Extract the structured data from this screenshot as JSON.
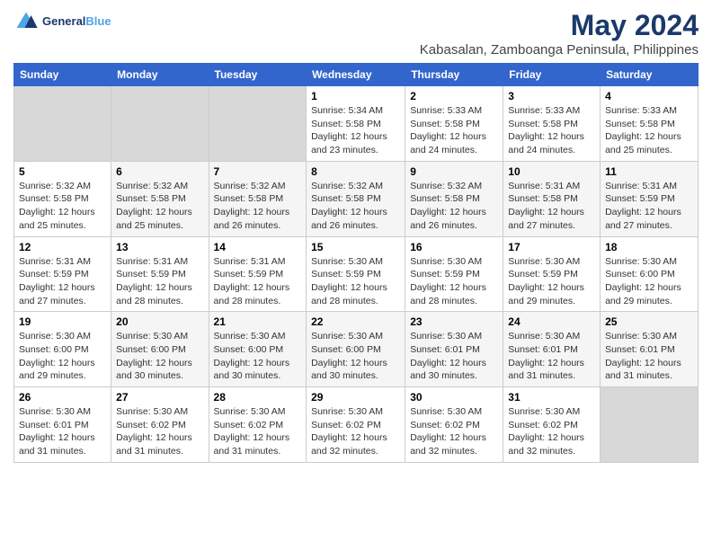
{
  "header": {
    "logo_line1": "General",
    "logo_line2": "Blue",
    "title": "May 2024",
    "subtitle": "Kabasalan, Zamboanga Peninsula, Philippines"
  },
  "calendar": {
    "days_of_week": [
      "Sunday",
      "Monday",
      "Tuesday",
      "Wednesday",
      "Thursday",
      "Friday",
      "Saturday"
    ],
    "weeks": [
      [
        {
          "day": "",
          "info": ""
        },
        {
          "day": "",
          "info": ""
        },
        {
          "day": "",
          "info": ""
        },
        {
          "day": "1",
          "info": "Sunrise: 5:34 AM\nSunset: 5:58 PM\nDaylight: 12 hours\nand 23 minutes."
        },
        {
          "day": "2",
          "info": "Sunrise: 5:33 AM\nSunset: 5:58 PM\nDaylight: 12 hours\nand 24 minutes."
        },
        {
          "day": "3",
          "info": "Sunrise: 5:33 AM\nSunset: 5:58 PM\nDaylight: 12 hours\nand 24 minutes."
        },
        {
          "day": "4",
          "info": "Sunrise: 5:33 AM\nSunset: 5:58 PM\nDaylight: 12 hours\nand 25 minutes."
        }
      ],
      [
        {
          "day": "5",
          "info": "Sunrise: 5:32 AM\nSunset: 5:58 PM\nDaylight: 12 hours\nand 25 minutes."
        },
        {
          "day": "6",
          "info": "Sunrise: 5:32 AM\nSunset: 5:58 PM\nDaylight: 12 hours\nand 25 minutes."
        },
        {
          "day": "7",
          "info": "Sunrise: 5:32 AM\nSunset: 5:58 PM\nDaylight: 12 hours\nand 26 minutes."
        },
        {
          "day": "8",
          "info": "Sunrise: 5:32 AM\nSunset: 5:58 PM\nDaylight: 12 hours\nand 26 minutes."
        },
        {
          "day": "9",
          "info": "Sunrise: 5:32 AM\nSunset: 5:58 PM\nDaylight: 12 hours\nand 26 minutes."
        },
        {
          "day": "10",
          "info": "Sunrise: 5:31 AM\nSunset: 5:58 PM\nDaylight: 12 hours\nand 27 minutes."
        },
        {
          "day": "11",
          "info": "Sunrise: 5:31 AM\nSunset: 5:59 PM\nDaylight: 12 hours\nand 27 minutes."
        }
      ],
      [
        {
          "day": "12",
          "info": "Sunrise: 5:31 AM\nSunset: 5:59 PM\nDaylight: 12 hours\nand 27 minutes."
        },
        {
          "day": "13",
          "info": "Sunrise: 5:31 AM\nSunset: 5:59 PM\nDaylight: 12 hours\nand 28 minutes."
        },
        {
          "day": "14",
          "info": "Sunrise: 5:31 AM\nSunset: 5:59 PM\nDaylight: 12 hours\nand 28 minutes."
        },
        {
          "day": "15",
          "info": "Sunrise: 5:30 AM\nSunset: 5:59 PM\nDaylight: 12 hours\nand 28 minutes."
        },
        {
          "day": "16",
          "info": "Sunrise: 5:30 AM\nSunset: 5:59 PM\nDaylight: 12 hours\nand 28 minutes."
        },
        {
          "day": "17",
          "info": "Sunrise: 5:30 AM\nSunset: 5:59 PM\nDaylight: 12 hours\nand 29 minutes."
        },
        {
          "day": "18",
          "info": "Sunrise: 5:30 AM\nSunset: 6:00 PM\nDaylight: 12 hours\nand 29 minutes."
        }
      ],
      [
        {
          "day": "19",
          "info": "Sunrise: 5:30 AM\nSunset: 6:00 PM\nDaylight: 12 hours\nand 29 minutes."
        },
        {
          "day": "20",
          "info": "Sunrise: 5:30 AM\nSunset: 6:00 PM\nDaylight: 12 hours\nand 30 minutes."
        },
        {
          "day": "21",
          "info": "Sunrise: 5:30 AM\nSunset: 6:00 PM\nDaylight: 12 hours\nand 30 minutes."
        },
        {
          "day": "22",
          "info": "Sunrise: 5:30 AM\nSunset: 6:00 PM\nDaylight: 12 hours\nand 30 minutes."
        },
        {
          "day": "23",
          "info": "Sunrise: 5:30 AM\nSunset: 6:01 PM\nDaylight: 12 hours\nand 30 minutes."
        },
        {
          "day": "24",
          "info": "Sunrise: 5:30 AM\nSunset: 6:01 PM\nDaylight: 12 hours\nand 31 minutes."
        },
        {
          "day": "25",
          "info": "Sunrise: 5:30 AM\nSunset: 6:01 PM\nDaylight: 12 hours\nand 31 minutes."
        }
      ],
      [
        {
          "day": "26",
          "info": "Sunrise: 5:30 AM\nSunset: 6:01 PM\nDaylight: 12 hours\nand 31 minutes."
        },
        {
          "day": "27",
          "info": "Sunrise: 5:30 AM\nSunset: 6:02 PM\nDaylight: 12 hours\nand 31 minutes."
        },
        {
          "day": "28",
          "info": "Sunrise: 5:30 AM\nSunset: 6:02 PM\nDaylight: 12 hours\nand 31 minutes."
        },
        {
          "day": "29",
          "info": "Sunrise: 5:30 AM\nSunset: 6:02 PM\nDaylight: 12 hours\nand 32 minutes."
        },
        {
          "day": "30",
          "info": "Sunrise: 5:30 AM\nSunset: 6:02 PM\nDaylight: 12 hours\nand 32 minutes."
        },
        {
          "day": "31",
          "info": "Sunrise: 5:30 AM\nSunset: 6:02 PM\nDaylight: 12 hours\nand 32 minutes."
        },
        {
          "day": "",
          "info": ""
        }
      ]
    ]
  }
}
